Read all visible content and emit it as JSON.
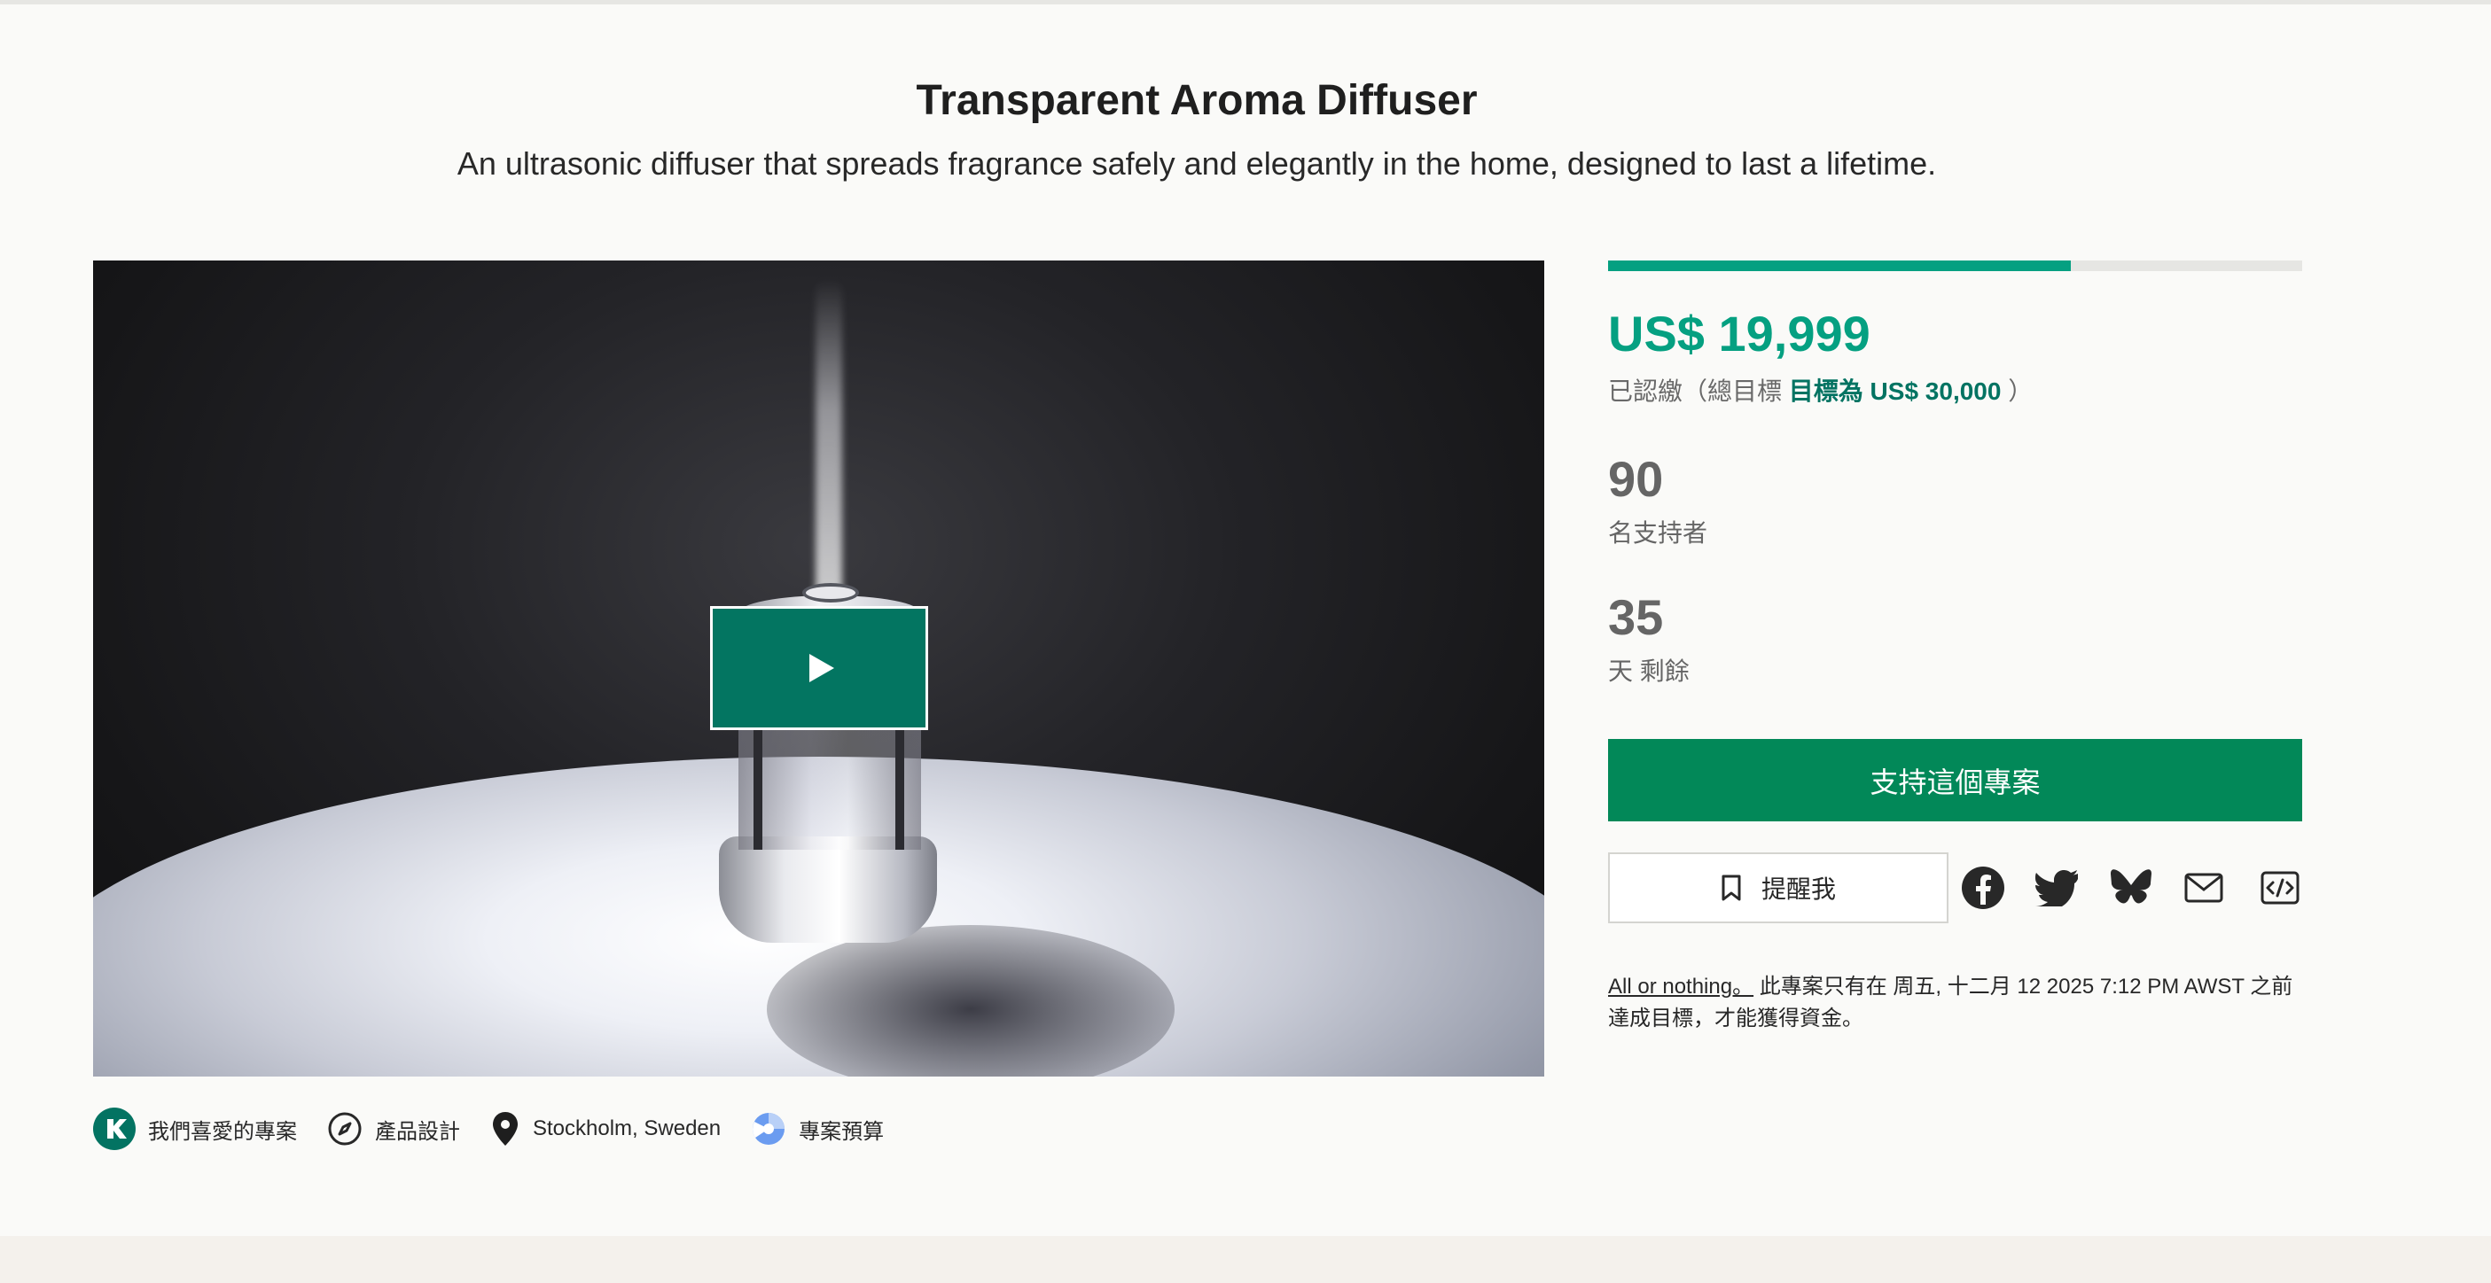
{
  "project": {
    "title": "Transparent Aroma Diffuser",
    "subtitle": "An ultrasonic diffuser that spreads fragrance safely and elegantly in the home, designed to last a lifetime."
  },
  "video": {
    "play_icon": "play-icon",
    "progress_fraction": 0.667
  },
  "tags": [
    {
      "icon": "kickstarter-k-icon",
      "label": "我們喜愛的專案"
    },
    {
      "icon": "compass-icon",
      "label": "產品設計"
    },
    {
      "icon": "location-pin-icon",
      "label": "Stockholm, Sweden"
    },
    {
      "icon": "budget-icon",
      "label": "專案預算"
    }
  ],
  "funding": {
    "pledged": "US$ 19,999",
    "goal_prefix": "已認繳（總目標 ",
    "goal_strong": "目標為 US$ 30,000",
    "goal_suffix": " ）",
    "backers_count": "90",
    "backers_label": "名支持者",
    "days_count": "35",
    "days_label": "天 剩餘"
  },
  "actions": {
    "back_label": "支持這個專案",
    "remind_label": "提醒我",
    "remind_icon": "bookmark-icon",
    "share_icons": [
      "facebook-icon",
      "twitter-icon",
      "bluesky-icon",
      "mail-icon",
      "embed-icon"
    ]
  },
  "all_or_nothing": {
    "link": "All or nothing。",
    "text": " 此專案只有在 周五, 十二月 12 2025 7:12 PM AWST 之前達成目標，才能獲得資金。"
  },
  "colors": {
    "accent": "#05a081",
    "accent_dark": "#037362",
    "button": "#028858",
    "play_button": "#037561"
  }
}
